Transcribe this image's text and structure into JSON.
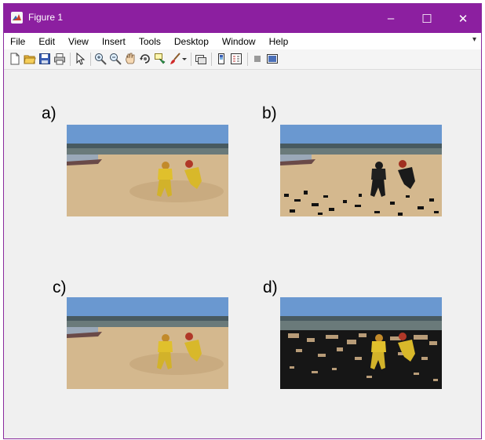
{
  "window": {
    "title": "Figure 1"
  },
  "window_controls": {
    "minimize": "–",
    "maximize": "☐",
    "close": "✕"
  },
  "menu": [
    "File",
    "Edit",
    "View",
    "Insert",
    "Tools",
    "Desktop",
    "Window",
    "Help"
  ],
  "menu_overflow": "▾",
  "toolbar": [
    "new-figure-icon",
    "open-file-icon",
    "save-icon",
    "print-icon",
    "pointer-icon",
    "zoom-in-icon",
    "zoom-out-icon",
    "pan-icon",
    "rotate-3d-icon",
    "data-cursor-icon",
    "brush-icon",
    "brush-dropdown-icon",
    "link-plot-icon",
    "insert-colorbar-icon",
    "insert-legend-icon",
    "hide-plot-tools-icon",
    "show-plot-tools-icon"
  ],
  "panels": [
    {
      "label": "a)",
      "variant": "original"
    },
    {
      "label": "b)",
      "variant": "dark-people"
    },
    {
      "label": "c)",
      "variant": "original"
    },
    {
      "label": "d)",
      "variant": "dark-ground"
    }
  ],
  "colors": {
    "titlebar": "#8c1fa0",
    "canvas": "#f0f0f0"
  }
}
